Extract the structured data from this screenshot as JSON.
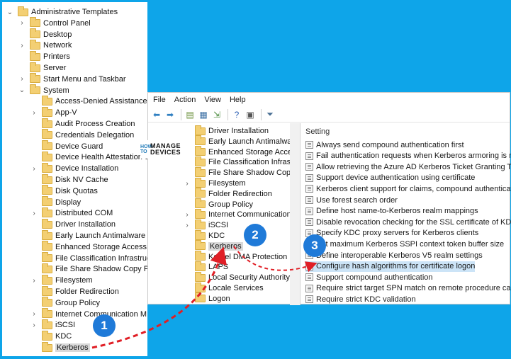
{
  "left_tree": [
    {
      "label": "Administrative Templates",
      "level": 0,
      "chev": "v"
    },
    {
      "label": "Control Panel",
      "level": 1,
      "chev": ">"
    },
    {
      "label": "Desktop",
      "level": 1,
      "chev": ""
    },
    {
      "label": "Network",
      "level": 1,
      "chev": ">"
    },
    {
      "label": "Printers",
      "level": 1,
      "chev": ""
    },
    {
      "label": "Server",
      "level": 1,
      "chev": ""
    },
    {
      "label": "Start Menu and Taskbar",
      "level": 1,
      "chev": ">"
    },
    {
      "label": "System",
      "level": 1,
      "chev": "v"
    },
    {
      "label": "Access-Denied Assistance",
      "level": 2,
      "chev": ""
    },
    {
      "label": "App-V",
      "level": 2,
      "chev": ">"
    },
    {
      "label": "Audit Process Creation",
      "level": 2,
      "chev": ""
    },
    {
      "label": "Credentials Delegation",
      "level": 2,
      "chev": ""
    },
    {
      "label": "Device Guard",
      "level": 2,
      "chev": ""
    },
    {
      "label": "Device Health Attestation S",
      "level": 2,
      "chev": ""
    },
    {
      "label": "Device Installation",
      "level": 2,
      "chev": ">"
    },
    {
      "label": "Disk NV Cache",
      "level": 2,
      "chev": ""
    },
    {
      "label": "Disk Quotas",
      "level": 2,
      "chev": ""
    },
    {
      "label": "Display",
      "level": 2,
      "chev": ""
    },
    {
      "label": "Distributed COM",
      "level": 2,
      "chev": ">"
    },
    {
      "label": "Driver Installation",
      "level": 2,
      "chev": ""
    },
    {
      "label": "Early Launch Antimalware",
      "level": 2,
      "chev": ""
    },
    {
      "label": "Enhanced Storage Access",
      "level": 2,
      "chev": ""
    },
    {
      "label": "File Classification Infrastruc",
      "level": 2,
      "chev": ""
    },
    {
      "label": "File Share Shadow Copy Pr",
      "level": 2,
      "chev": ""
    },
    {
      "label": "Filesystem",
      "level": 2,
      "chev": ">"
    },
    {
      "label": "Folder Redirection",
      "level": 2,
      "chev": ""
    },
    {
      "label": "Group Policy",
      "level": 2,
      "chev": ""
    },
    {
      "label": "Internet Communication M",
      "level": 2,
      "chev": ">"
    },
    {
      "label": "iSCSI",
      "level": 2,
      "chev": ">"
    },
    {
      "label": "KDC",
      "level": 2,
      "chev": ""
    },
    {
      "label": "Kerberos",
      "level": 2,
      "chev": "",
      "selected": true
    }
  ],
  "menubar": [
    "File",
    "Action",
    "View",
    "Help"
  ],
  "toolbar": [
    {
      "icon": "back-arrow-icon",
      "glyph": "⬅",
      "color": "#2f7fc1"
    },
    {
      "icon": "forward-arrow-icon",
      "glyph": "➡",
      "color": "#2f7fc1"
    },
    {
      "icon": "up-folder-icon",
      "glyph": "▤",
      "color": "#6a8f3a"
    },
    {
      "icon": "show-hide-tree-icon",
      "glyph": "▦",
      "color": "#3b6fa3"
    },
    {
      "icon": "export-list-icon",
      "glyph": "⇲",
      "color": "#4a8a3c"
    },
    {
      "icon": "help-icon",
      "glyph": "?",
      "color": "#2d5fb4"
    },
    {
      "icon": "properties-icon",
      "glyph": "▣",
      "color": "#555555"
    },
    {
      "icon": "filter-icon",
      "glyph": "⏷",
      "color": "#4a6f94"
    }
  ],
  "mmc_tree": [
    {
      "label": "Driver Installation",
      "chev": ""
    },
    {
      "label": "Early Launch Antimalware",
      "chev": ""
    },
    {
      "label": "Enhanced Storage Access",
      "chev": ""
    },
    {
      "label": "File Classification Infrastru",
      "chev": ""
    },
    {
      "label": "File Share Shadow Copy Pr",
      "chev": ""
    },
    {
      "label": "Filesystem",
      "chev": ">"
    },
    {
      "label": "Folder Redirection",
      "chev": ""
    },
    {
      "label": "Group Policy",
      "chev": ""
    },
    {
      "label": "Internet Communication N",
      "chev": ">"
    },
    {
      "label": "iSCSI",
      "chev": ">"
    },
    {
      "label": "KDC",
      "chev": ""
    },
    {
      "label": "Kerberos",
      "chev": "",
      "selected": true
    },
    {
      "label": "Kernel DMA Protection",
      "chev": ""
    },
    {
      "label": "LAPS",
      "chev": ""
    },
    {
      "label": "Local Security Authority",
      "chev": ""
    },
    {
      "label": "Locale Services",
      "chev": ""
    },
    {
      "label": "Logon",
      "chev": ""
    }
  ],
  "list_header": "Setting",
  "settings": [
    {
      "label": "Always send compound authentication first"
    },
    {
      "label": "Fail authentication requests when Kerberos armoring is not ..."
    },
    {
      "label": "Allow retrieving the Azure AD Kerberos Ticket Granting Ticke..."
    },
    {
      "label": "Support device authentication using certificate"
    },
    {
      "label": "Kerberos client support for claims, compound authenticatio..."
    },
    {
      "label": "Use forest search order"
    },
    {
      "label": "Define host name-to-Kerberos realm mappings"
    },
    {
      "label": "Disable revocation checking for the SSL certificate of KDC pr..."
    },
    {
      "label": "Specify KDC proxy servers for Kerberos clients"
    },
    {
      "label": "Set maximum Kerberos SSPI context token buffer size"
    },
    {
      "label": "Define interoperable Kerberos V5 realm settings"
    },
    {
      "label": "Configure hash algorithms for certificate logon",
      "selected": true
    },
    {
      "label": "Support compound authentication"
    },
    {
      "label": "Require strict target SPN match on remote procedure calls"
    },
    {
      "label": "Require strict KDC validation"
    }
  ],
  "logo": {
    "how": "HOW TO",
    "line1": "MANAGE",
    "line2": "DEVICES"
  },
  "badges": [
    "1",
    "2",
    "3"
  ],
  "colors": {
    "background": "#0ea5e9",
    "badge": "#1f7ad8",
    "arrow": "#e01f26",
    "selection": "#cce4f7"
  }
}
